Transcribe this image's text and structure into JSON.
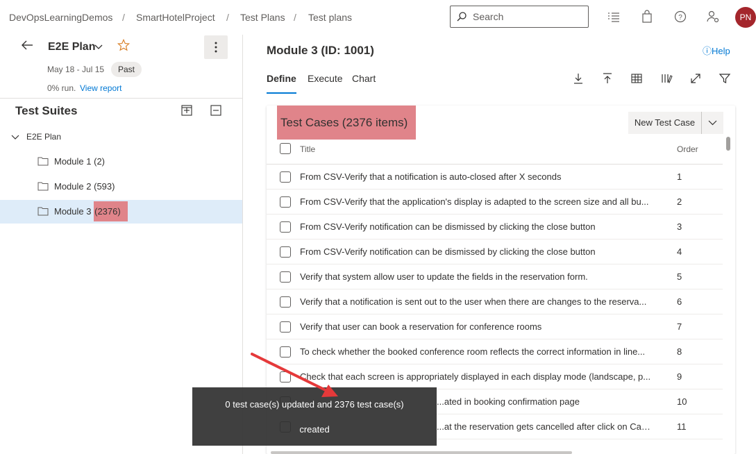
{
  "breadcrumb": {
    "items": [
      "DevOpsLearningDemos",
      "SmartHotelProject",
      "Test Plans",
      "Test plans"
    ],
    "separator": "/"
  },
  "search": {
    "placeholder": "Search"
  },
  "header": {
    "avatar_initials": "PN",
    "avatar_color": "#a4262c"
  },
  "plan": {
    "name": "E2E Plan",
    "dates": "May 18 - Jul 15",
    "status": "Past",
    "run": "0% run.",
    "view_report": "View report"
  },
  "suites": {
    "title": "Test Suites",
    "root": "E2E Plan",
    "items": [
      {
        "name": "Module 1",
        "count": "(2)"
      },
      {
        "name": "Module 2",
        "count": "(593)"
      },
      {
        "name": "Module 3",
        "count": "(2376)"
      }
    ],
    "selected_index": 2
  },
  "main": {
    "title": "Module 3 (ID: 1001)",
    "help": "Help",
    "tabs": [
      "Define",
      "Execute",
      "Chart"
    ],
    "active_tab": 0
  },
  "test_cases": {
    "heading": "Test Cases (2376 items)",
    "new_button": "New Test Case",
    "columns": {
      "title": "Title",
      "order": "Order"
    },
    "rows": [
      {
        "title": "From CSV-Verify that a notification is auto-closed after X seconds",
        "order": "1"
      },
      {
        "title": "From CSV-Verify that the application's display is adapted to the screen size and all bu...",
        "order": "2"
      },
      {
        "title": "From CSV-Verify notification can be dismissed by clicking the close button",
        "order": "3"
      },
      {
        "title": "From CSV-Verify notification can be dismissed by clicking the close button",
        "order": "4"
      },
      {
        "title": "Verify that system allow user to update the fields in the reservation form.",
        "order": "5"
      },
      {
        "title": "Verify that a notification is sent out to the user when there are changes to the reserva...",
        "order": "6"
      },
      {
        "title": "Verify that user can book a reservation for conference rooms",
        "order": "7"
      },
      {
        "title": "To check whether the booked conference room reflects the correct information in line...",
        "order": "8"
      },
      {
        "title": "Check that each screen is appropriately displayed in each display mode (landscape, p...",
        "order": "9"
      },
      {
        "title": "...ated in booking confirmation page",
        "order": "10"
      },
      {
        "title": "...at the reservation gets cancelled after click on Cancel order number link",
        "order": "11"
      }
    ]
  },
  "toast": {
    "line1": "0 test case(s) updated and 2376 test case(s)",
    "line2": "created"
  },
  "colors": {
    "accent": "#0078d4",
    "highlight": "#e0848a",
    "annotation_arrow": "#e5393a"
  }
}
